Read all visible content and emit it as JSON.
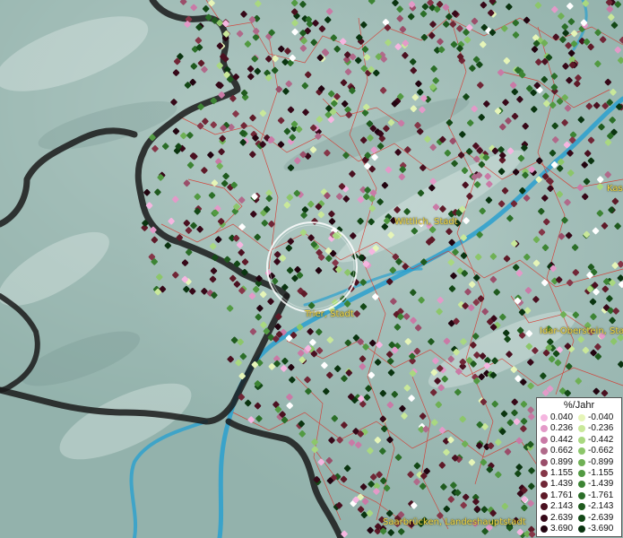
{
  "places": [
    {
      "id": "wittlich",
      "label": "Wittlich, Stadt"
    },
    {
      "id": "trier",
      "label": "Trier, Stadt"
    },
    {
      "id": "idar",
      "label": "Idar-Oberstein, Sta"
    },
    {
      "id": "saarbruecken",
      "label": "Saarbrücken, Landeshauptstadt"
    },
    {
      "id": "kas",
      "label": "Kas"
    }
  ],
  "legend": {
    "title": "%/Jahr",
    "positive": [
      "0.040",
      "0.236",
      "0.442",
      "0.662",
      "0.899",
      "1.155",
      "1.439",
      "1.761",
      "2.143",
      "2.639",
      "3.690"
    ],
    "negative": [
      "-0.040",
      "-0.236",
      "-0.442",
      "-0.662",
      "-0.899",
      "-1.155",
      "-1.439",
      "-1.761",
      "-2.143",
      "-2.639",
      "-3.690"
    ],
    "positive_colors": [
      "#f5b6e0",
      "#e39ac8",
      "#c97aa6",
      "#b06a8a",
      "#9a4e6a",
      "#853648",
      "#702636",
      "#5e1a28",
      "#4a1020",
      "#360818",
      "#220410"
    ],
    "negative_colors": [
      "#e6f5b8",
      "#c9e89a",
      "#a9d880",
      "#8cc66a",
      "#6fb055",
      "#529a42",
      "#3d8434",
      "#2b6e28",
      "#1f5a1e",
      "#134816",
      "#0a3410"
    ]
  }
}
